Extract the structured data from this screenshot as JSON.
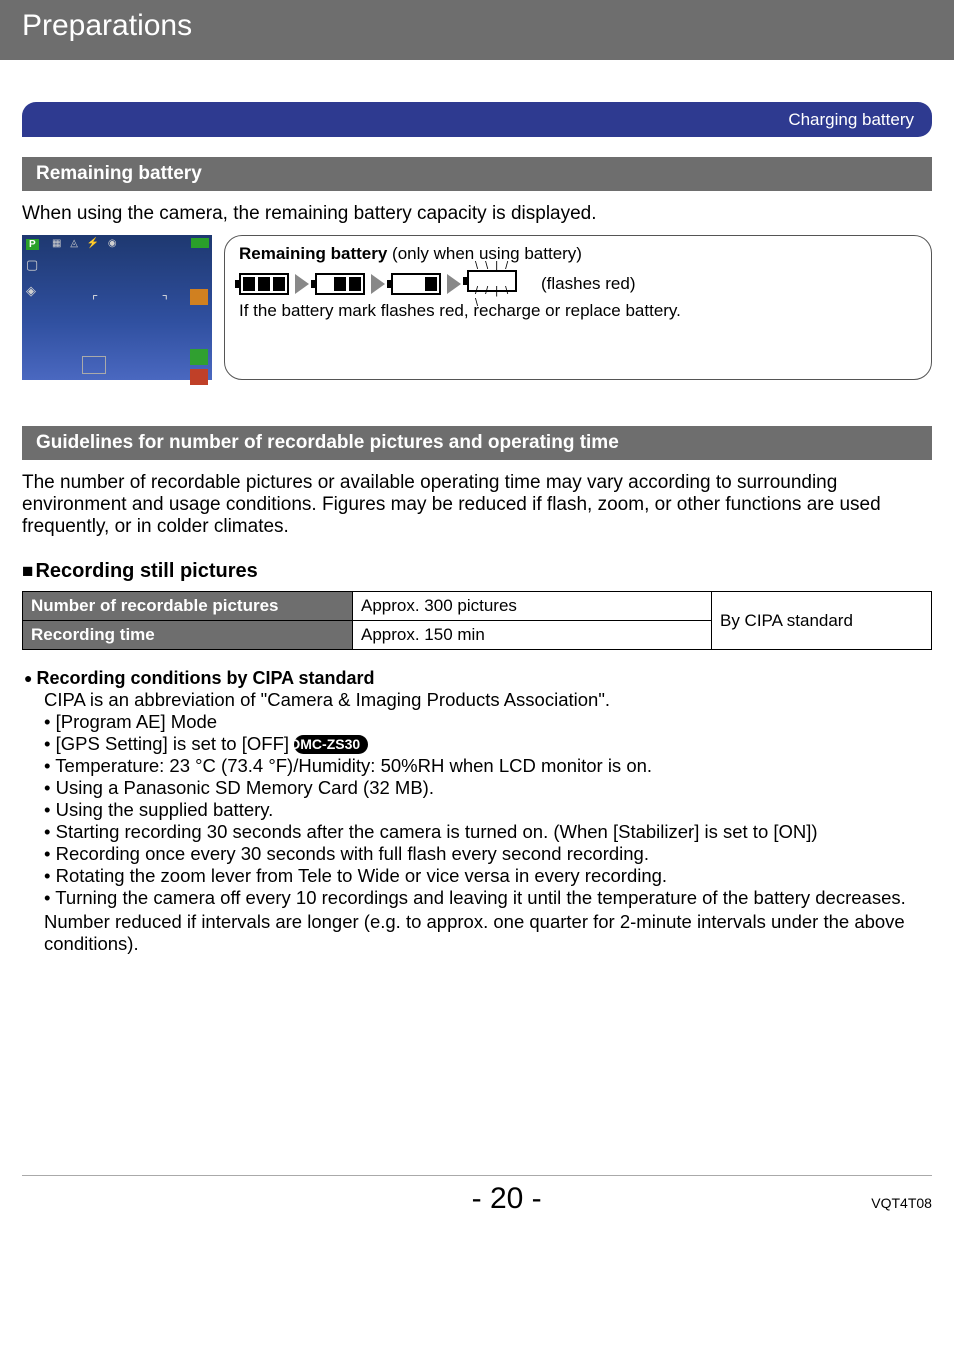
{
  "header": {
    "title": "Preparations"
  },
  "ribbon": {
    "label": "Charging battery"
  },
  "section_remaining": {
    "title": "Remaining battery",
    "intro": "When using the camera, the remaining battery capacity is displayed.",
    "callout_title_bold": "Remaining battery",
    "callout_title_rest": " (only when using battery)",
    "flashes_label": "(flashes red)",
    "callout_note": "If the battery mark flashes red, recharge or replace battery."
  },
  "section_guidelines": {
    "title": "Guidelines for number of recordable pictures and operating time",
    "para": "The number of recordable pictures or available operating time may vary according to surrounding environment and usage conditions. Figures may be reduced if flash, zoom, or other functions are used frequently, or in colder climates."
  },
  "still_pictures": {
    "heading": "Recording still pictures",
    "table": {
      "rows": [
        {
          "label": "Number of recordable pictures",
          "value": "Approx. 300 pictures"
        },
        {
          "label": "Recording time",
          "value": "Approx. 150 min"
        }
      ],
      "standard": "By CIPA standard"
    }
  },
  "cipa": {
    "heading": "Recording conditions by CIPA standard",
    "line1": "CIPA is an abbreviation of \"Camera & Imaging Products Association\".",
    "items": [
      "[Program AE] Mode",
      "[GPS Setting] is set to [OFF] ",
      "Temperature: 23 °C (73.4 °F)/Humidity: 50%RH when LCD monitor is on.",
      "Using a Panasonic SD Memory Card (32 MB).",
      "Using the supplied battery.",
      "Starting recording 30 seconds after the camera is turned on. (When [Stabilizer] is set to [ON])",
      "Recording once every 30 seconds with full flash every second recording.",
      "Rotating the zoom lever from Tele to Wide or vice versa in every recording.",
      "Turning the camera off every 10 recordings and leaving it until the temperature of the battery decreases."
    ],
    "model_badge": "DMC-ZS30",
    "followup": "Number reduced if intervals are longer (e.g. to approx. one quarter for 2-minute intervals under the above conditions)."
  },
  "footer": {
    "page": "- 20 -",
    "code": "VQT4T08"
  }
}
